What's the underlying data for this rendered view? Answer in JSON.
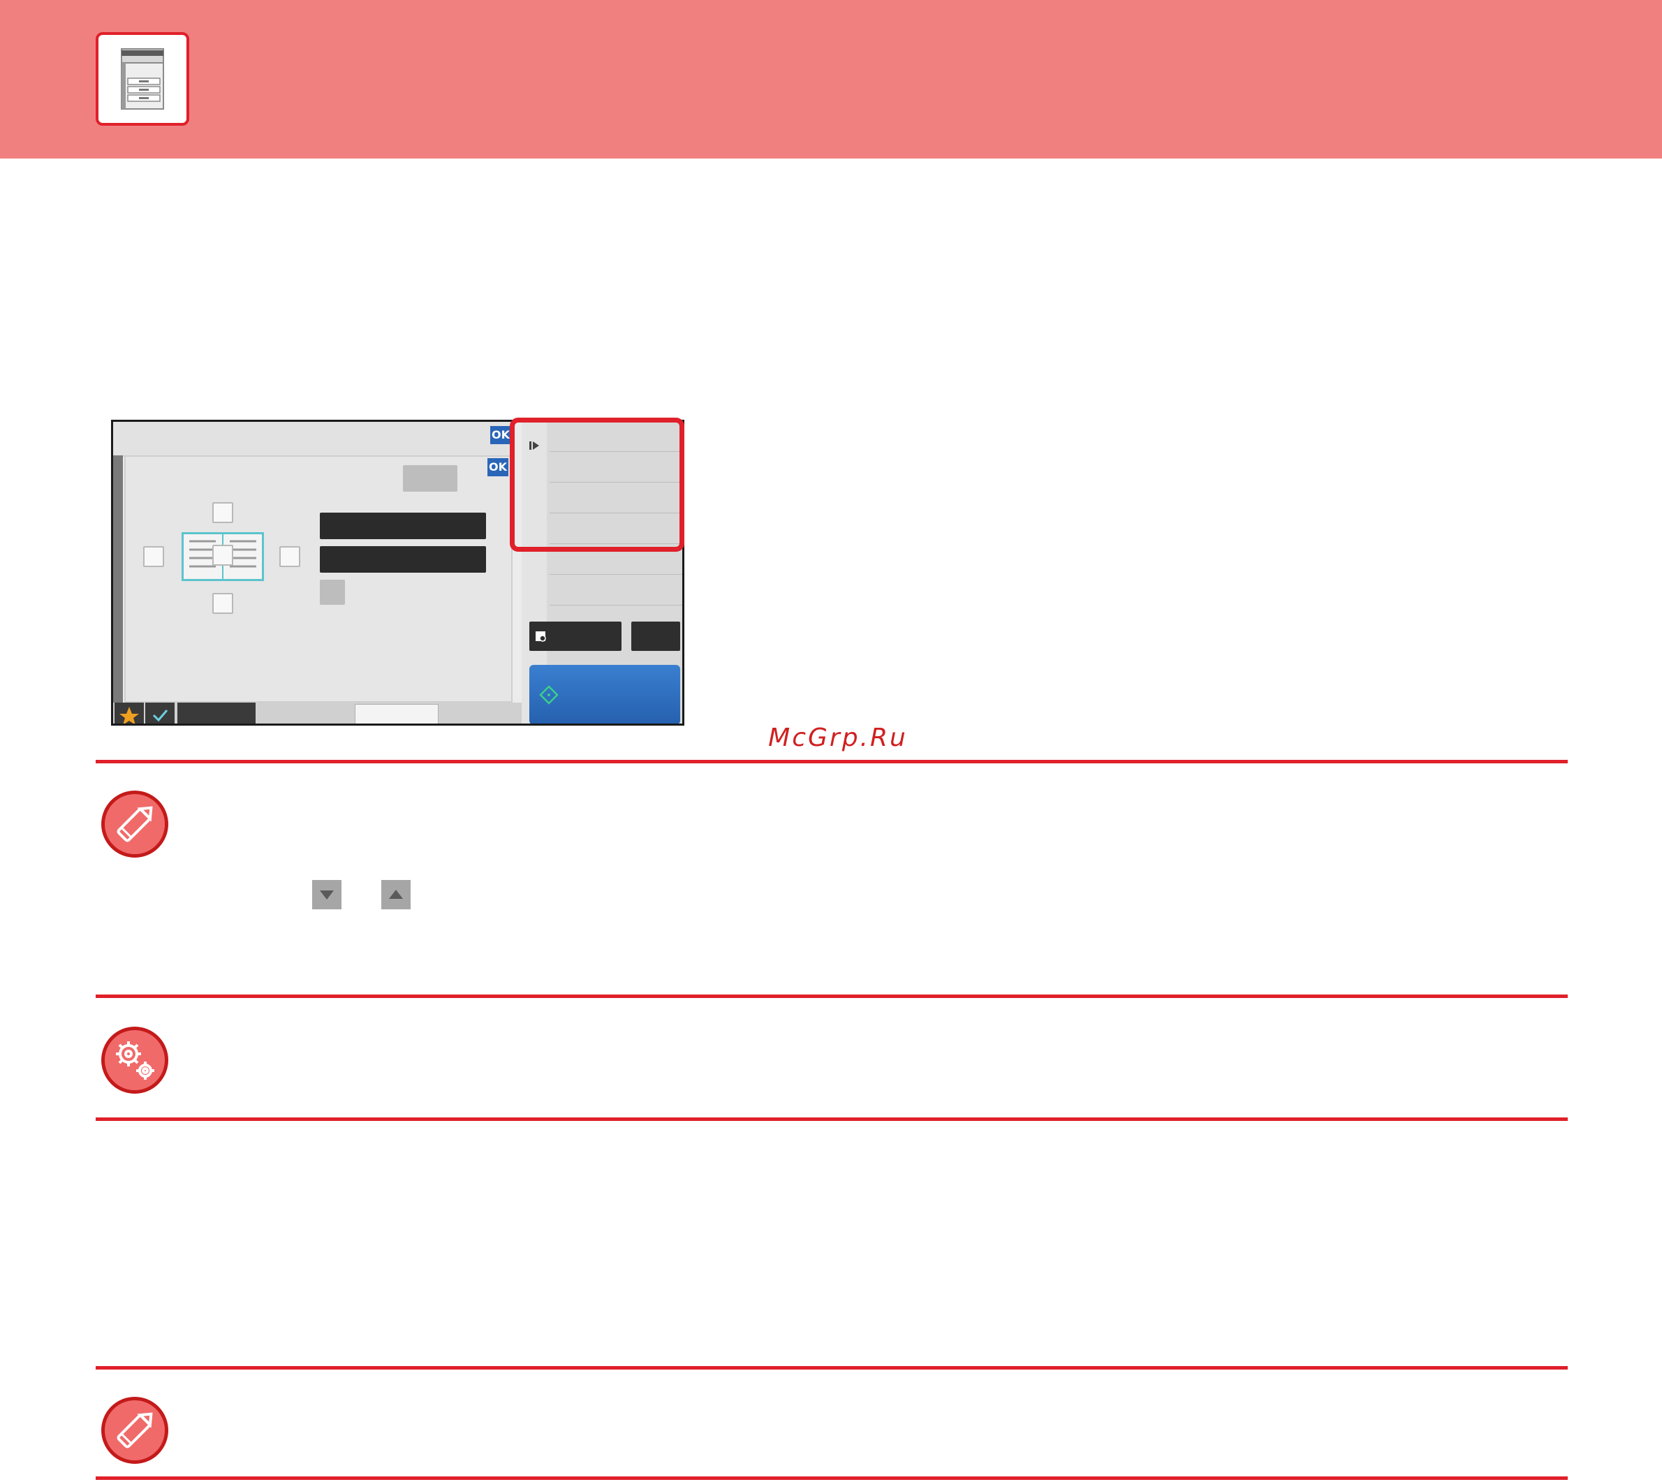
{
  "watermark": "McGrp.Ru",
  "screenshot": {
    "ok_label": "OK"
  },
  "icons": {
    "header": "copier-machine-icon",
    "note1": "pencil-note-icon",
    "settings": "gears-settings-icon",
    "note2": "pencil-note-icon",
    "down": "triangle-down-icon",
    "up": "triangle-up-icon"
  },
  "colors": {
    "header_band": "#f08080",
    "accent_red": "#e0202a",
    "start_button_blue": "#2a66b8"
  }
}
